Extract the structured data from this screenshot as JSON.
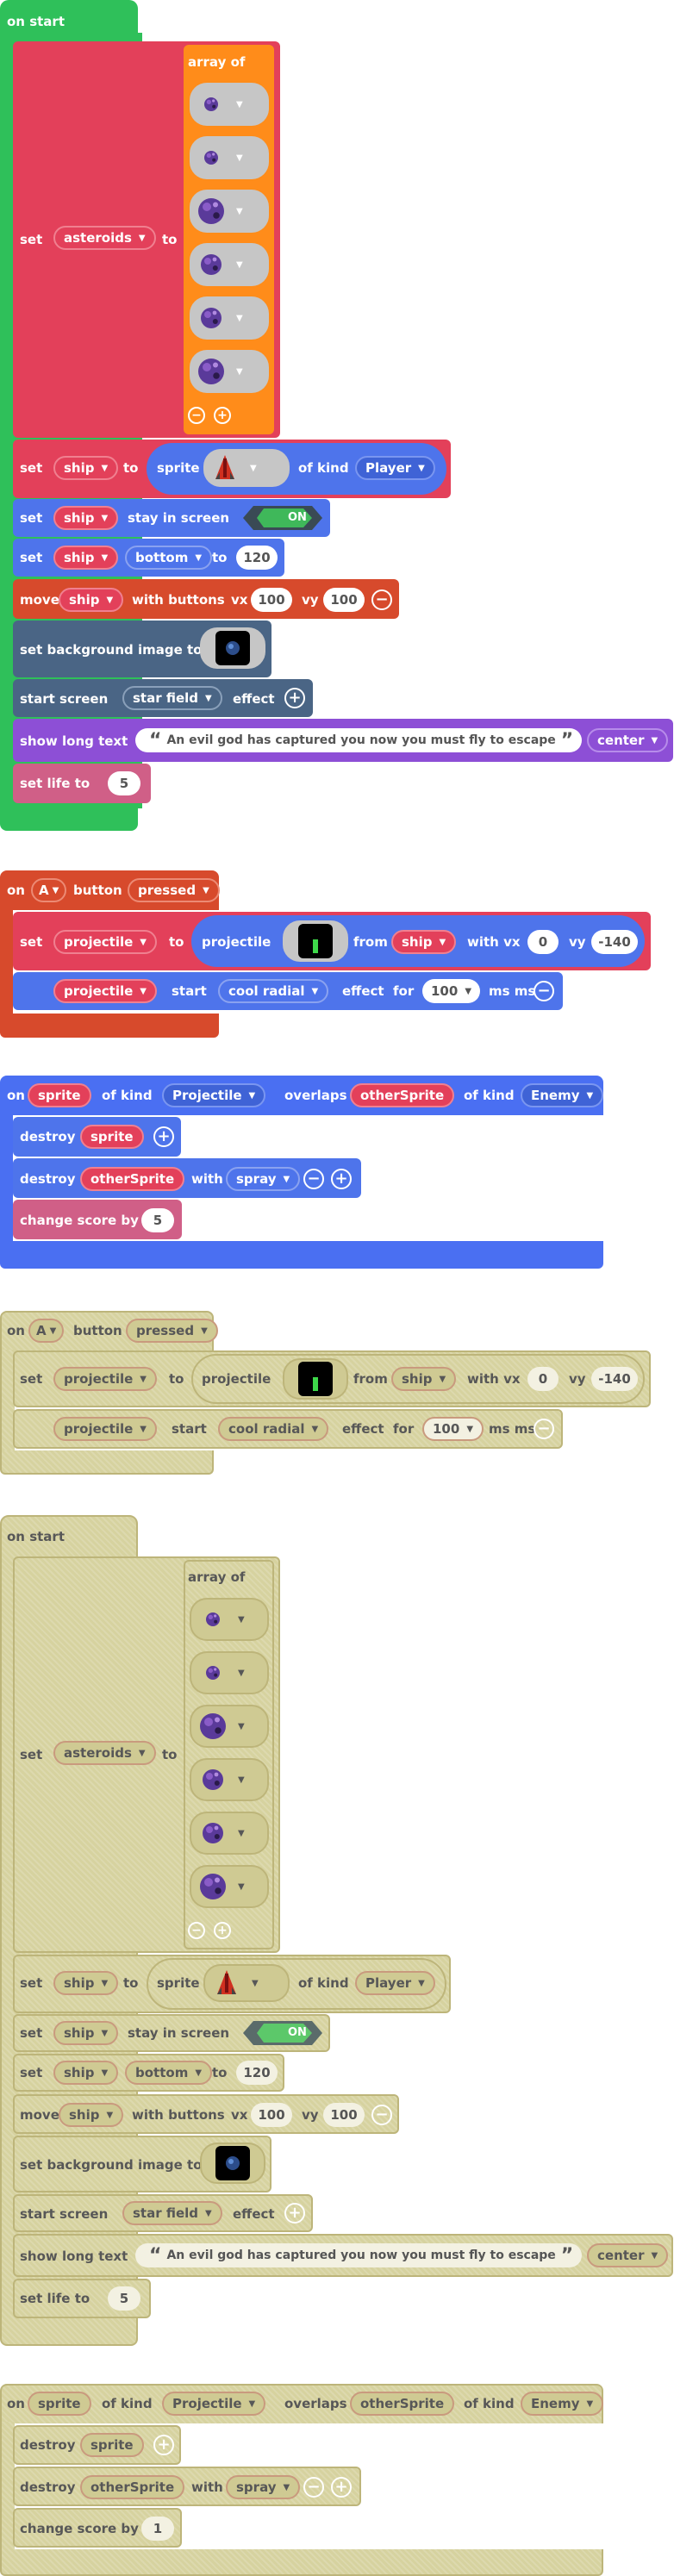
{
  "on_start": {
    "title": "on start",
    "set_label": "set",
    "to_label": "to",
    "array_of": "array of",
    "asteroids_var": "asteroids",
    "asteroid_icons": [
      "asteroid-small-icon",
      "asteroid-small-icon",
      "asteroid-large-icon",
      "asteroid-medium-icon",
      "asteroid-medium-icon",
      "asteroid-large-icon"
    ],
    "ship_var": "ship",
    "sprite_label": "sprite",
    "of_kind_label": "of kind",
    "kind_player": "Player",
    "stay_in_screen": "stay in screen",
    "on_label": "ON",
    "bottom_prop": "bottom",
    "bottom_value": "120",
    "move_label": "move",
    "with_buttons": "with buttons",
    "vx_label": "vx",
    "vx_value": "100",
    "vy_label": "vy",
    "vy_value": "100",
    "set_bg_label": "set background image to",
    "start_screen_label": "start screen",
    "effect_value": "star field",
    "effect_label": "effect",
    "show_long_text": "show long text",
    "long_text": "An evil god has captured you now you must fly to escape",
    "align_value": "center",
    "set_life_label": "set life to",
    "life_value": "5"
  },
  "on_button": {
    "on_label": "on",
    "button_key": "A",
    "button_label": "button",
    "event_value": "pressed",
    "set_label": "set",
    "projectile_var": "projectile",
    "to_label": "to",
    "projectile_label": "projectile",
    "from_label": "from",
    "ship_var": "ship",
    "with_vx": "with vx",
    "vx_value": "0",
    "vy_label": "vy",
    "vy_value": "-140",
    "start_label": "start",
    "effect_value": "cool radial",
    "effect_label": "effect",
    "for_label": "for",
    "duration_value": "100",
    "ms_label": "ms ms"
  },
  "on_overlap": {
    "on_label": "on",
    "sprite_var": "sprite",
    "of_kind_label": "of kind",
    "kind_projectile": "Projectile",
    "overlaps_label": "overlaps",
    "other_sprite_var": "otherSprite",
    "kind_enemy": "Enemy",
    "destroy_label": "destroy",
    "with_label": "with",
    "destroy_effect": "spray",
    "change_score_label": "change score by",
    "score_value": "5",
    "score_value_disabled": "1"
  },
  "colors": {
    "event_green": "#2fc05a",
    "sprites_red": "#e3405a",
    "arrays_orange": "#ff8c1a",
    "controller_red": "#d74a2c",
    "scene_slate": "#4a6585",
    "game_purple": "#8d4fd6",
    "info_pink": "#d05f87",
    "overlap_blue": "#4a6ff2",
    "effects_blue": "#4e74eb",
    "disabled_olive": "#d6d29f"
  }
}
